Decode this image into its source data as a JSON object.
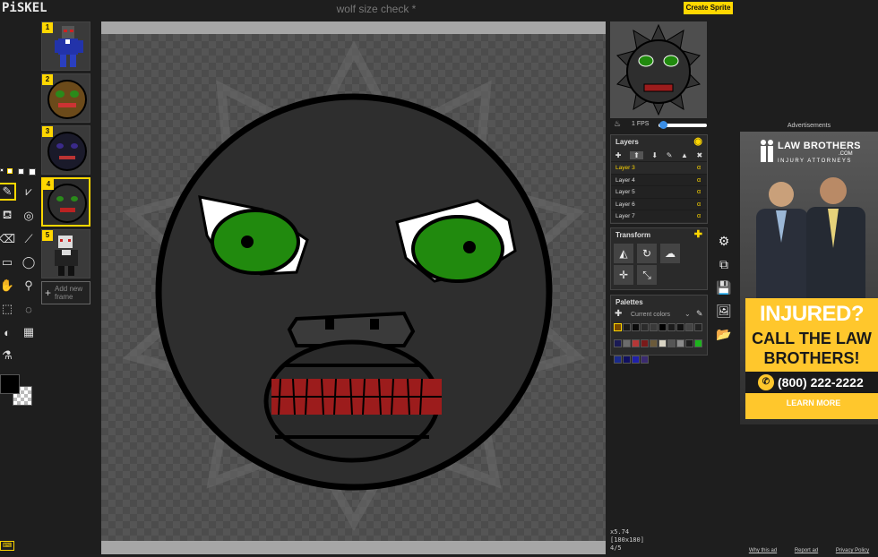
{
  "app": {
    "logo": "PiSKEL",
    "title": "wolf size check *",
    "create_sprite": "Create Sprite"
  },
  "frames": [
    {
      "num": "1",
      "label": "wolf-suit-frame"
    },
    {
      "num": "2",
      "label": "brown-face-frame"
    },
    {
      "num": "3",
      "label": "dark-face-frame"
    },
    {
      "num": "4",
      "label": "black-face-frame"
    },
    {
      "num": "5",
      "label": "white-wolf-frame"
    }
  ],
  "add_frame": "Add new frame",
  "preview": {
    "fps_label": "1 FPS",
    "fps_value": 0.02
  },
  "layers": {
    "title": "Layers",
    "items": [
      {
        "name": "Layer 3",
        "alpha": "α"
      },
      {
        "name": "Layer 4",
        "alpha": "α"
      },
      {
        "name": "Layer 5",
        "alpha": "α"
      },
      {
        "name": "Layer 6",
        "alpha": "α"
      },
      {
        "name": "Layer 7",
        "alpha": "α"
      }
    ]
  },
  "transform": {
    "title": "Transform"
  },
  "palettes": {
    "title": "Palettes",
    "current": "Current colors",
    "swatches_row1": [
      "#7a4a00",
      "#1a1a1a",
      "#0a0a0a",
      "#2b2b2b",
      "#3a3a3a",
      "#000000",
      "#1c1c1c",
      "#111111",
      "#444444",
      "#222222"
    ],
    "swatches_row2": [
      "#1b1b55",
      "#6c6c6c",
      "#b43737",
      "#7a1a1a",
      "#6b5a3a",
      "#d9d4c4",
      "#555555",
      "#8b8b8b",
      "#1f1f1f",
      "#1db41d"
    ],
    "swatches_row3": [
      "#1a2a8a",
      "#101060",
      "#2020aa",
      "#3a2a70"
    ]
  },
  "zoom": {
    "zoom_level": "x5.74",
    "size": "[180x180]",
    "frame_index": "4/5"
  },
  "ad": {
    "label": "Advertisements",
    "brand1": "LAW BROTHERS",
    "brand2": ".COM",
    "brand3": "INJURY ATTORNEYS",
    "injured": "INJURED?",
    "call": "CALL THE LAW BROTHERS!",
    "phone": "(800) 222-2222",
    "learn": "LEARN MORE",
    "why": "Why this ad",
    "report": "Report ad",
    "privacy": "Privacy Policy"
  },
  "colors": {
    "primary": "#000000",
    "accent": "#ffd700"
  }
}
